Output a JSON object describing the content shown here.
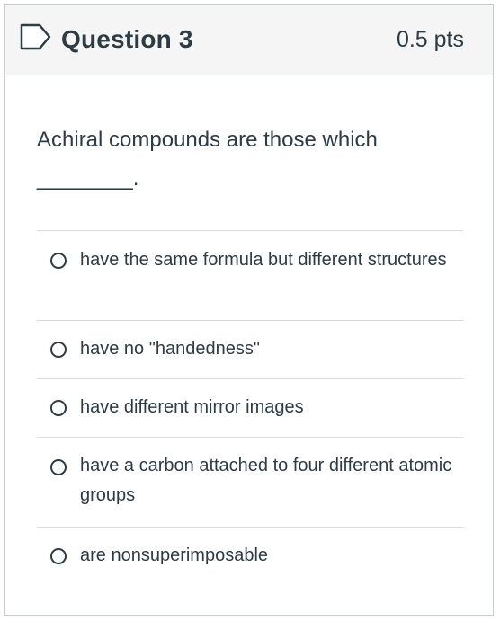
{
  "question": {
    "title": "Question 3",
    "points": "0.5 pts",
    "prompt": "Achiral compounds are those which ________.",
    "answers": [
      {
        "label": "have the same formula but different structures",
        "selected": false
      },
      {
        "label": "have no \"handedness\"",
        "selected": false
      },
      {
        "label": "have different mirror images",
        "selected": false
      },
      {
        "label": "have a carbon attached to four different atomic groups",
        "selected": false
      },
      {
        "label": "are nonsuperimposable",
        "selected": false
      }
    ]
  },
  "icons": {
    "flag": "flag-outline-icon",
    "radio": "radio-button-empty-icon"
  },
  "colors": {
    "text": "#2d3b45",
    "header_bg": "#f5f5f5",
    "border": "#c7cdd1",
    "divider": "#d9dde0"
  }
}
